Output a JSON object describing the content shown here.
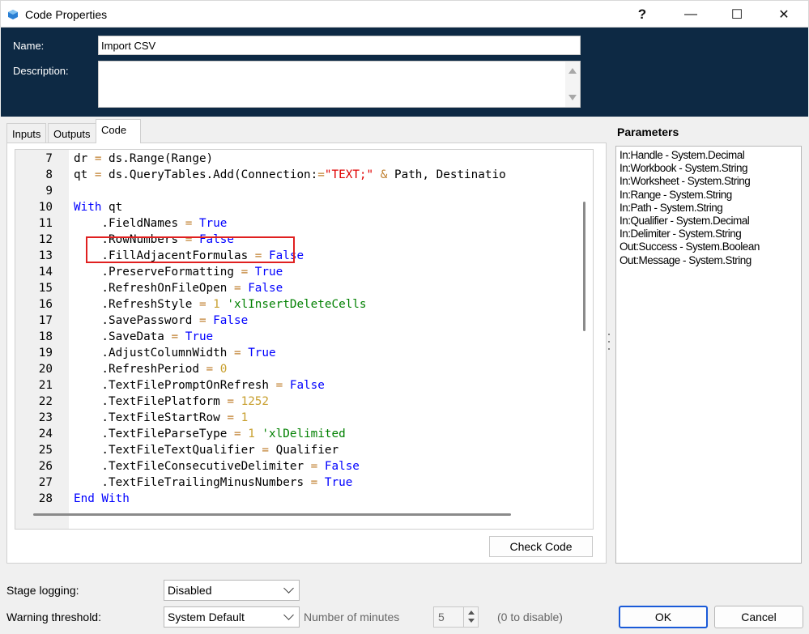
{
  "window": {
    "title": "Code Properties",
    "help_glyph": "?",
    "minimize_glyph": "—",
    "maximize_glyph": "☐",
    "close_glyph": "✕"
  },
  "header": {
    "name_label": "Name:",
    "name_value": "Import CSV",
    "description_label": "Description:",
    "description_value": ""
  },
  "tabs": [
    {
      "label": "Inputs",
      "active": false
    },
    {
      "label": "Outputs",
      "active": false
    },
    {
      "label": "Code",
      "active": true
    }
  ],
  "code": {
    "lines": [
      {
        "n": "7",
        "parts": [
          [
            "",
            "dr "
          ],
          [
            "op",
            "="
          ],
          [
            "",
            " ds.Range(Range)"
          ]
        ]
      },
      {
        "n": "8",
        "parts": [
          [
            "",
            "qt "
          ],
          [
            "op",
            "="
          ],
          [
            "",
            " ds.QueryTables.Add(Connection:"
          ],
          [
            "op",
            "="
          ],
          [
            "str",
            "\"TEXT;\""
          ],
          [
            "",
            " "
          ],
          [
            "op",
            "&"
          ],
          [
            "",
            " Path, Destinatio"
          ]
        ]
      },
      {
        "n": "9",
        "parts": []
      },
      {
        "n": "10",
        "parts": [
          [
            "kw",
            "With"
          ],
          [
            "",
            " qt"
          ]
        ]
      },
      {
        "n": "11",
        "parts": [
          [
            "",
            "    .FieldNames "
          ],
          [
            "op",
            "="
          ],
          [
            "kw",
            " True"
          ]
        ]
      },
      {
        "n": "12",
        "parts": [
          [
            "",
            "    .RowNumbers "
          ],
          [
            "op",
            "="
          ],
          [
            "kw",
            " False"
          ]
        ]
      },
      {
        "n": "13",
        "parts": [
          [
            "",
            "    .FillAdjacentFormulas "
          ],
          [
            "op",
            "="
          ],
          [
            "kw",
            " False"
          ]
        ]
      },
      {
        "n": "14",
        "parts": [
          [
            "",
            "    .PreserveFormatting "
          ],
          [
            "op",
            "="
          ],
          [
            "kw",
            " True"
          ]
        ]
      },
      {
        "n": "15",
        "parts": [
          [
            "",
            "    .RefreshOnFileOpen "
          ],
          [
            "op",
            "="
          ],
          [
            "kw",
            " False"
          ]
        ]
      },
      {
        "n": "16",
        "parts": [
          [
            "",
            "    .RefreshStyle "
          ],
          [
            "op",
            "="
          ],
          [
            "num",
            " 1"
          ],
          [
            "cmt",
            " 'xlInsertDeleteCells"
          ]
        ]
      },
      {
        "n": "17",
        "parts": [
          [
            "",
            "    .SavePassword "
          ],
          [
            "op",
            "="
          ],
          [
            "kw",
            " False"
          ]
        ]
      },
      {
        "n": "18",
        "parts": [
          [
            "",
            "    .SaveData "
          ],
          [
            "op",
            "="
          ],
          [
            "kw",
            " True"
          ]
        ]
      },
      {
        "n": "19",
        "parts": [
          [
            "",
            "    .AdjustColumnWidth "
          ],
          [
            "op",
            "="
          ],
          [
            "kw",
            " True"
          ]
        ]
      },
      {
        "n": "20",
        "parts": [
          [
            "",
            "    .RefreshPeriod "
          ],
          [
            "op",
            "="
          ],
          [
            "num",
            " 0"
          ]
        ]
      },
      {
        "n": "21",
        "parts": [
          [
            "",
            "    .TextFilePromptOnRefresh "
          ],
          [
            "op",
            "="
          ],
          [
            "kw",
            " False"
          ]
        ]
      },
      {
        "n": "22",
        "parts": [
          [
            "",
            "    .TextFilePlatform "
          ],
          [
            "op",
            "="
          ],
          [
            "num",
            " 1252"
          ]
        ]
      },
      {
        "n": "23",
        "parts": [
          [
            "",
            "    .TextFileStartRow "
          ],
          [
            "op",
            "="
          ],
          [
            "num",
            " 1"
          ]
        ]
      },
      {
        "n": "24",
        "parts": [
          [
            "",
            "    .TextFileParseType "
          ],
          [
            "op",
            "="
          ],
          [
            "num",
            " 1"
          ],
          [
            "cmt",
            " 'xlDelimited"
          ]
        ]
      },
      {
        "n": "25",
        "parts": [
          [
            "",
            "    .TextFileTextQualifier "
          ],
          [
            "op",
            "="
          ],
          [
            "",
            " Qualifier"
          ]
        ]
      },
      {
        "n": "26",
        "parts": [
          [
            "",
            "    .TextFileConsecutiveDelimiter "
          ],
          [
            "op",
            "="
          ],
          [
            "kw",
            " False"
          ]
        ]
      },
      {
        "n": "27",
        "parts": [
          [
            "",
            "    .TextFileTrailingMinusNumbers "
          ],
          [
            "op",
            "="
          ],
          [
            "kw",
            " True"
          ]
        ]
      },
      {
        "n": "28",
        "parts": [
          [
            "kw",
            "End With"
          ]
        ]
      }
    ],
    "highlighted_line": "22"
  },
  "check_code_label": "Check Code",
  "parameters": {
    "title": "Parameters",
    "items": [
      "In:Handle - System.Decimal",
      "In:Workbook - System.String",
      "In:Worksheet - System.String",
      "In:Range - System.String",
      "In:Path - System.String",
      "In:Qualifier - System.Decimal",
      "In:Delimiter - System.String",
      "Out:Success - System.Boolean",
      "Out:Message - System.String"
    ]
  },
  "footer": {
    "stage_logging_label": "Stage logging:",
    "stage_logging_value": "Disabled",
    "warning_threshold_label": "Warning threshold:",
    "warning_threshold_value": "System Default",
    "number_of_minutes_label": "Number of minutes",
    "minutes_value": "5",
    "disable_hint": "(0 to disable)",
    "ok_label": "OK",
    "cancel_label": "Cancel"
  },
  "colors": {
    "header_bg": "#0d2944",
    "keyword": "#0000ff",
    "string": "#e00000",
    "number": "#c8a030",
    "comment": "#008000",
    "highlight_box": "#e02020"
  }
}
